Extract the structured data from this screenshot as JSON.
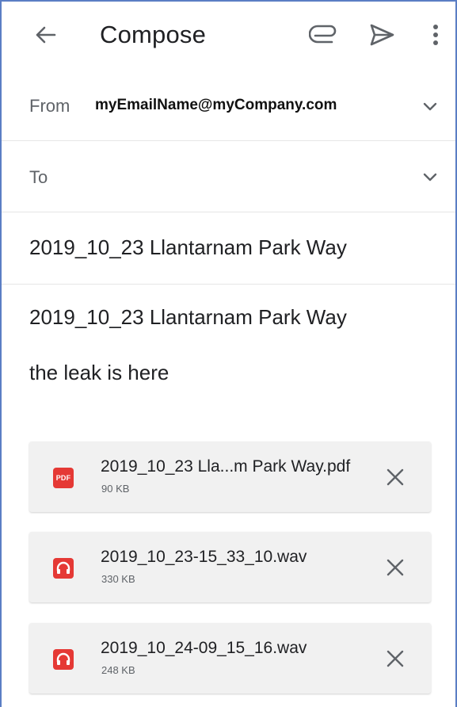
{
  "header": {
    "title": "Compose",
    "icons": [
      "back-arrow-icon",
      "paperclip-icon",
      "send-icon",
      "more-vert-icon"
    ]
  },
  "from": {
    "label": "From",
    "value": "myEmailName@myCompany.com"
  },
  "to": {
    "label": "To"
  },
  "subject": "2019_10_23 Llantarnam Park Way",
  "body": {
    "line1": "2019_10_23 Llantarnam Park Way",
    "line2": "the leak is here"
  },
  "attachments": [
    {
      "name": "2019_10_23 Lla...m Park Way.pdf",
      "size": "90 KB",
      "icon": "pdf-icon",
      "icon_text": "PDF"
    },
    {
      "name": "2019_10_23-15_33_10.wav",
      "size": "330 KB",
      "icon": "audio-icon"
    },
    {
      "name": "2019_10_24-09_15_16.wav",
      "size": "248 KB",
      "icon": "audio-icon"
    }
  ],
  "colors": {
    "frame_border": "#5b7ec4",
    "attachment_icon": "#e53935",
    "attachment_bg": "#f1f1f1",
    "icon_gray": "#5f6368"
  }
}
